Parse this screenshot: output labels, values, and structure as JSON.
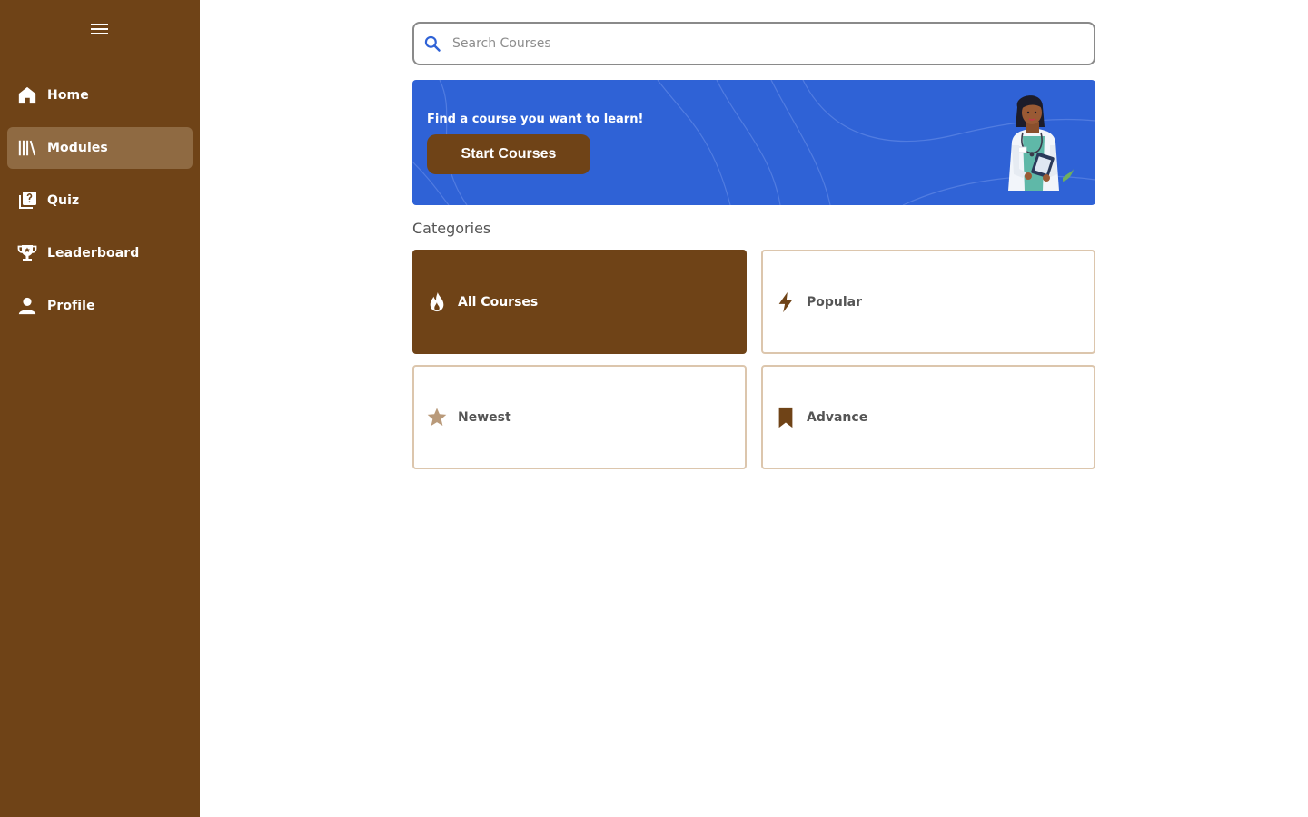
{
  "sidebar": {
    "menu_icon": "hamburger-menu-icon",
    "items": [
      {
        "label": "Home",
        "icon": "home-icon",
        "active": false
      },
      {
        "label": "Modules",
        "icon": "library-icon",
        "active": true
      },
      {
        "label": "Quiz",
        "icon": "quiz-icon",
        "active": false
      },
      {
        "label": "Leaderboard",
        "icon": "trophy-icon",
        "active": false
      },
      {
        "label": "Profile",
        "icon": "person-icon",
        "active": false
      }
    ]
  },
  "search": {
    "placeholder": "Search Courses",
    "value": "",
    "icon": "search-icon"
  },
  "banner": {
    "text": "Find a course you want to learn!",
    "button_label": "Start Courses",
    "image": "doctor-illustration"
  },
  "categories": {
    "title": "Categories",
    "items": [
      {
        "label": "All Courses",
        "icon": "fire-icon",
        "selected": true
      },
      {
        "label": "Popular",
        "icon": "lightning-icon",
        "selected": false
      },
      {
        "label": "Newest",
        "icon": "star-icon",
        "selected": false
      },
      {
        "label": "Advance",
        "icon": "bookmark-icon",
        "selected": false
      }
    ]
  },
  "colors": {
    "sidebar": "#6f4317",
    "sidebar_active": "#8f6a42",
    "banner": "#2f62d6",
    "accent": "#6f4317",
    "card_border": "#dcc6ad"
  }
}
